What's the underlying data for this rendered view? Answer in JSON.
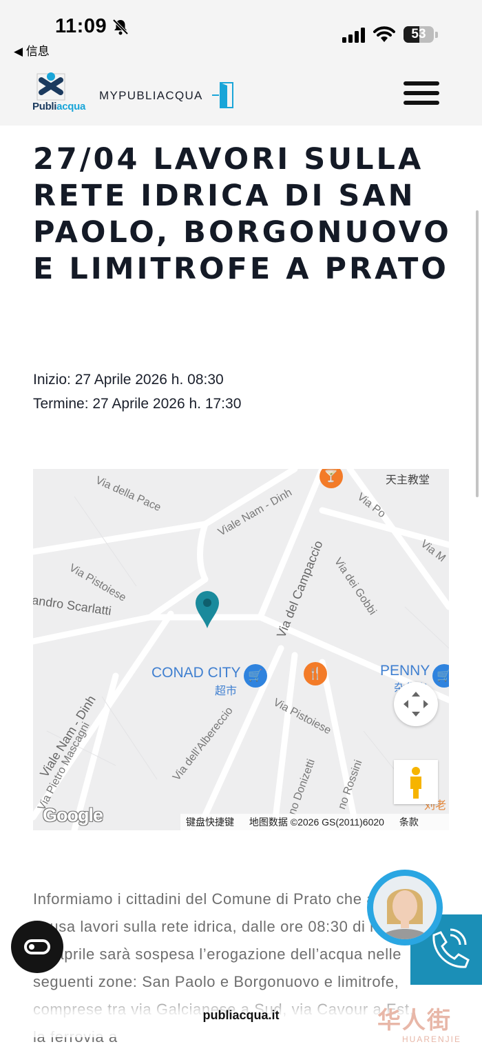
{
  "status_bar": {
    "time": "11:09",
    "back_label": "◀ 信息",
    "battery": "53"
  },
  "header": {
    "logo_text_dark": "Publi",
    "logo_text_accent": "acqua",
    "mypubliacqua": "MYPUBLIACQUA",
    "menu_icon": "hamburger-icon"
  },
  "article": {
    "title": "27/04 LAVORI SULLA RETE IDRICA DI SAN PAOLO, BORGONUOVO E LIMITROFE A PRATO",
    "start": "Inizio: 27 Aprile 2026 h. 08:30",
    "end": "Termine: 27 Aprile 2026 h. 17:30",
    "body": "Informiamo i cittadini del Comune di Prato che a causa lavori sulla rete idrica, dalle ore 08:30 di lunedì 27 aprile sarà sospesa l’erogazione dell’acqua nelle seguenti zone: San Paolo e Borgonuovo e limitrofe, comprese tra via Galcianese a Sud, via Cavour a Est, la ferrovia a"
  },
  "map": {
    "streets": {
      "pace": "Via della Pace",
      "nam_dinh_top": "Viale Nam - Dinh",
      "po": "Via Po",
      "m": "Via M",
      "pistoiese_1": "Via Pistoiese",
      "scarlatti": "andro Scarlatti",
      "campaccio": "Via del Campaccio",
      "gobbi": "Via dei Gobbi",
      "pistoiese_2": "Via Pistoiese",
      "albereccio": "Via dell’Albereccio",
      "nam_dinh_left": "Viale Nam - Dinh",
      "mascagni": "Via Pietro Mascagni",
      "donizetti": "no Donizetti",
      "rossini": "no Rossini"
    },
    "places": {
      "church": "天主教堂",
      "conad": "CONAD CITY",
      "conad_sub": "超市",
      "penny": "PENNY",
      "penny_sub": "杂货店",
      "corner": "刘老"
    },
    "google_logo": "Google",
    "attribution": {
      "shortcuts": "键盘快捷键",
      "data": "地图数据 ©2026 GS(2011)6020",
      "terms": "条款"
    },
    "accent_color": "#1a8a9c"
  },
  "footer": {
    "domain": "publiacqua.it",
    "watermark": "华人街",
    "watermark_sub": "HUARENJIE"
  }
}
